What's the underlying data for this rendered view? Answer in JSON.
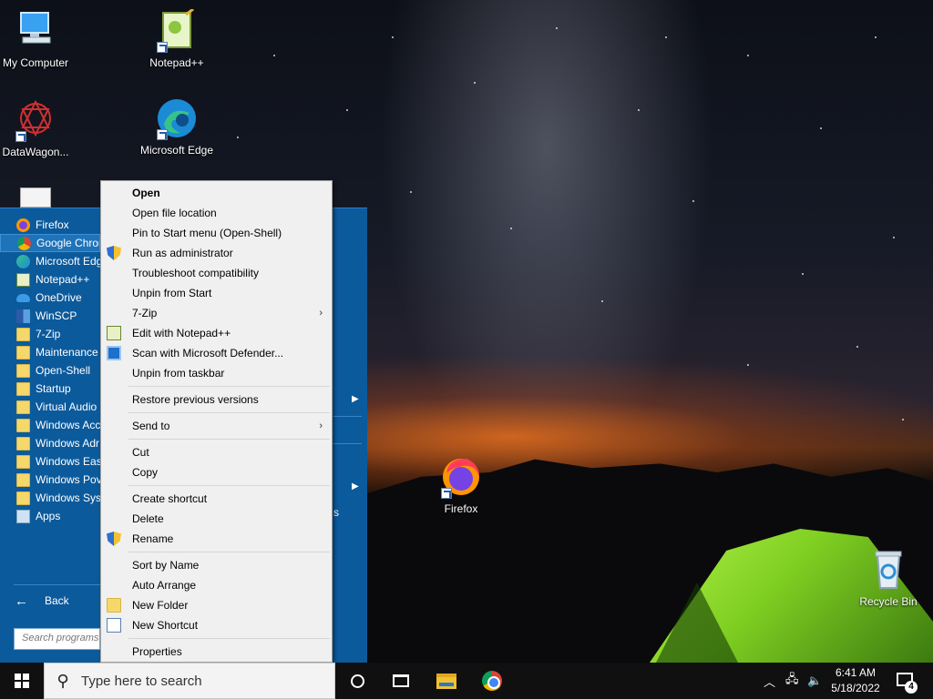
{
  "desktop": {
    "icons": [
      {
        "label": "My Computer"
      },
      {
        "label": "Notepad++"
      },
      {
        "label": "DataWagon..."
      },
      {
        "label": "Microsoft Edge"
      },
      {
        "label": "Firefox"
      },
      {
        "label": "Recycle Bin"
      }
    ]
  },
  "start_menu": {
    "programs": [
      {
        "label": "Firefox",
        "icon": "firefox-icon"
      },
      {
        "label": "Google Chrome",
        "icon": "chrome-icon"
      },
      {
        "label": "Microsoft Edge",
        "icon": "edge-icon"
      },
      {
        "label": "Notepad++",
        "icon": "notepad-plus-plus-icon"
      },
      {
        "label": "OneDrive",
        "icon": "onedrive-icon"
      },
      {
        "label": "WinSCP",
        "icon": "winscp-icon"
      },
      {
        "label": "7-Zip",
        "icon": "folder-icon"
      },
      {
        "label": "Maintenance",
        "icon": "folder-icon"
      },
      {
        "label": "Open-Shell",
        "icon": "folder-icon"
      },
      {
        "label": "Startup",
        "icon": "folder-icon"
      },
      {
        "label": "Virtual Audio",
        "icon": "folder-icon"
      },
      {
        "label": "Windows Acc",
        "icon": "folder-icon"
      },
      {
        "label": "Windows Adr",
        "icon": "folder-icon"
      },
      {
        "label": "Windows Eas",
        "icon": "folder-icon"
      },
      {
        "label": "Windows Pov",
        "icon": "folder-icon"
      },
      {
        "label": "Windows Syst",
        "icon": "folder-icon"
      },
      {
        "label": "Apps",
        "icon": "apps-icon"
      }
    ],
    "back_label": "Back",
    "search_placeholder": "Search programs",
    "right_fragment": "s"
  },
  "context_menu": {
    "items": [
      {
        "label": "Open",
        "bold": true
      },
      {
        "label": "Open file location"
      },
      {
        "label": "Pin to Start menu (Open-Shell)"
      },
      {
        "label": "Run as administrator",
        "icon": "uac-shield-icon"
      },
      {
        "label": "Troubleshoot compatibility"
      },
      {
        "label": "Unpin from Start"
      },
      {
        "label": "7-Zip",
        "submenu": true
      },
      {
        "label": "Edit with Notepad++",
        "icon": "notepad-plus-plus-icon"
      },
      {
        "label": "Scan with Microsoft Defender...",
        "icon": "defender-icon"
      },
      {
        "label": "Unpin from taskbar"
      },
      {
        "separator": true
      },
      {
        "label": "Restore previous versions"
      },
      {
        "separator": true
      },
      {
        "label": "Send to",
        "submenu": true
      },
      {
        "separator": true
      },
      {
        "label": "Cut"
      },
      {
        "label": "Copy"
      },
      {
        "separator": true
      },
      {
        "label": "Create shortcut"
      },
      {
        "label": "Delete"
      },
      {
        "label": "Rename",
        "icon": "uac-shield-icon"
      },
      {
        "separator": true
      },
      {
        "label": "Sort by Name"
      },
      {
        "label": "Auto Arrange"
      },
      {
        "label": "New Folder",
        "icon": "folder-icon"
      },
      {
        "label": "New Shortcut",
        "icon": "shortcut-icon"
      },
      {
        "separator": true
      },
      {
        "label": "Properties"
      }
    ]
  },
  "taskbar": {
    "search_placeholder": "Type here to search",
    "time": "6:41 AM",
    "date": "5/18/2022",
    "notification_count": "4"
  },
  "colors": {
    "start_menu_bg": "#0b5a9c",
    "menu_bg": "#f0f0f0",
    "taskbar_bg": "#101010"
  }
}
